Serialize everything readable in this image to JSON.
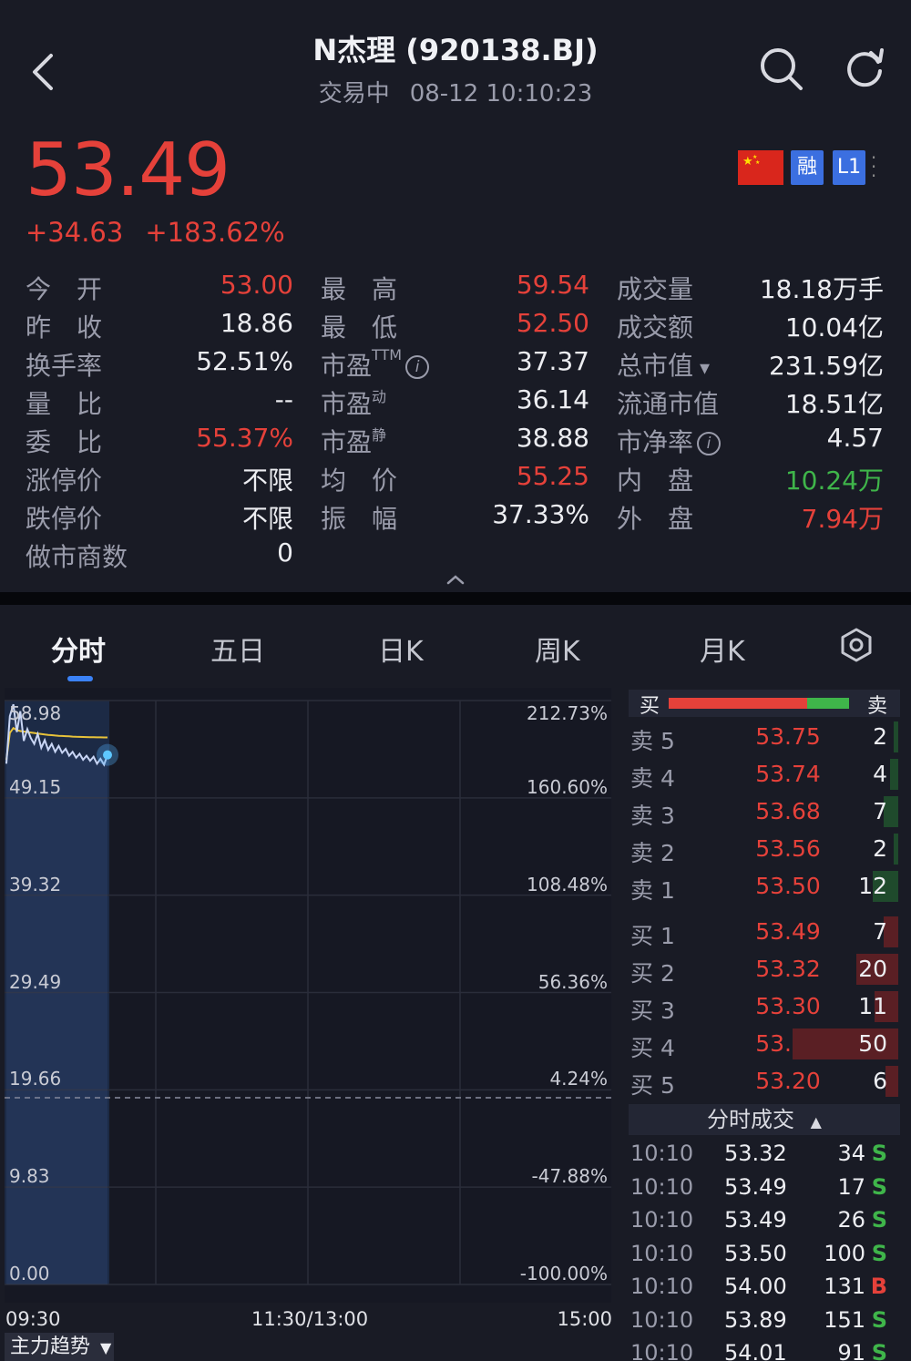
{
  "header": {
    "title": "N杰理 (920138.BJ)",
    "status": "交易中",
    "datetime": "08-12 10:10:23"
  },
  "quote": {
    "price": "53.49",
    "change": "+34.63",
    "change_pct": "+183.62%",
    "badges": {
      "margin": "融",
      "level": "L1"
    },
    "col1": [
      {
        "label": "今　开",
        "value": "53.00",
        "color": "red"
      },
      {
        "label": "昨　收",
        "value": "18.86",
        "color": "white"
      },
      {
        "label": "换手率",
        "value": "52.51%",
        "color": "white"
      },
      {
        "label": "量　比",
        "value": "--",
        "color": "white"
      },
      {
        "label": "委　比",
        "value": "55.37%",
        "color": "red"
      },
      {
        "label": "涨停价",
        "value": "不限",
        "color": "white"
      },
      {
        "label": "跌停价",
        "value": "不限",
        "color": "white"
      },
      {
        "label": "做市商数",
        "value": "0",
        "color": "white"
      }
    ],
    "col2": [
      {
        "label": "最　高",
        "value": "59.54",
        "color": "red"
      },
      {
        "label": "最　低",
        "value": "52.50",
        "color": "red"
      },
      {
        "label": "市盈",
        "sup": "TTM",
        "value": "37.37",
        "color": "white"
      },
      {
        "label": "市盈",
        "sup": "动",
        "value": "36.14",
        "color": "white"
      },
      {
        "label": "市盈",
        "sup": "静",
        "value": "38.88",
        "color": "white"
      },
      {
        "label": "均　价",
        "value": "55.25",
        "color": "red"
      },
      {
        "label": "振　幅",
        "value": "37.33%",
        "color": "white"
      }
    ],
    "col3": [
      {
        "label": "成交量",
        "value": "18.18万手",
        "color": "white"
      },
      {
        "label": "成交额",
        "value": "10.04亿",
        "color": "white"
      },
      {
        "label": "总市值",
        "value": "231.59亿",
        "color": "white"
      },
      {
        "label": "流通市值",
        "value": "18.51亿",
        "color": "white"
      },
      {
        "label": "市净率",
        "value": "4.57",
        "color": "white"
      },
      {
        "label": "内　盘",
        "value": "10.24万",
        "color": "green"
      },
      {
        "label": "外　盘",
        "value": "7.94万",
        "color": "red"
      }
    ]
  },
  "tabs": [
    "分时",
    "五日",
    "日K",
    "周K",
    "月K"
  ],
  "chart_data": {
    "type": "line",
    "y_price_ticks": [
      "58.98",
      "49.15",
      "39.32",
      "29.49",
      "19.66",
      "9.83",
      "0.00"
    ],
    "y_pct_ticks": [
      "212.73%",
      "160.60%",
      "108.48%",
      "56.36%",
      "4.24%",
      "-47.88%",
      "-100.00%"
    ],
    "x_ticks": [
      "09:30",
      "11:30/13:00",
      "15:00"
    ],
    "ylim": [
      0,
      58.98
    ],
    "prev_close": 18.86,
    "series": [
      {
        "values": [
          52.6,
          57.4,
          58.6,
          55.8,
          57.9,
          54.9,
          56.1,
          55.2,
          54.6,
          55.6,
          54.2,
          55.0,
          54.0,
          54.6,
          53.8,
          54.4,
          53.7,
          54.1,
          53.4,
          53.8,
          53.2,
          53.6,
          53.0,
          53.4,
          52.9,
          53.3,
          52.6,
          53.1,
          52.5,
          53.49
        ]
      },
      {
        "values": [
          53.0,
          55.7,
          56.2,
          56.0,
          55.9,
          55.85,
          55.8,
          55.75,
          55.7,
          55.65,
          55.6,
          55.55,
          55.5,
          55.48,
          55.45,
          55.42,
          55.4,
          55.38,
          55.36,
          55.34,
          55.32,
          55.31,
          55.3,
          55.29,
          55.28,
          55.27,
          55.26,
          55.26,
          55.25,
          55.25
        ]
      }
    ]
  },
  "orderbook": {
    "buy_label": "买",
    "sell_label": "卖",
    "asks": [
      {
        "label": "卖 5",
        "price": "53.75",
        "qty": "2",
        "ratio": 0.04
      },
      {
        "label": "卖 4",
        "price": "53.74",
        "qty": "4",
        "ratio": 0.08
      },
      {
        "label": "卖 3",
        "price": "53.68",
        "qty": "7",
        "ratio": 0.14
      },
      {
        "label": "卖 2",
        "price": "53.56",
        "qty": "2",
        "ratio": 0.04
      },
      {
        "label": "卖 1",
        "price": "53.50",
        "qty": "12",
        "ratio": 0.24
      }
    ],
    "bids": [
      {
        "label": "买 1",
        "price": "53.49",
        "qty": "7",
        "ratio": 0.14
      },
      {
        "label": "买 2",
        "price": "53.32",
        "qty": "20",
        "ratio": 0.4
      },
      {
        "label": "买 3",
        "price": "53.30",
        "qty": "11",
        "ratio": 0.22
      },
      {
        "label": "买 4",
        "price": "53.25",
        "qty": "50",
        "ratio": 1.0
      },
      {
        "label": "买 5",
        "price": "53.20",
        "qty": "6",
        "ratio": 0.12
      }
    ],
    "bid_share": 0.77
  },
  "ticks_title": "分时成交",
  "ticks": [
    {
      "time": "10:10",
      "price": "53.32",
      "vol": "34",
      "side": "S"
    },
    {
      "time": "10:10",
      "price": "53.49",
      "vol": "17",
      "side": "S"
    },
    {
      "time": "10:10",
      "price": "53.49",
      "vol": "26",
      "side": "S"
    },
    {
      "time": "10:10",
      "price": "53.50",
      "vol": "100",
      "side": "S"
    },
    {
      "time": "10:10",
      "price": "54.00",
      "vol": "131",
      "side": "B"
    },
    {
      "time": "10:10",
      "price": "53.89",
      "vol": "151",
      "side": "S"
    },
    {
      "time": "10:10",
      "price": "54.01",
      "vol": "91",
      "side": "S"
    }
  ],
  "trend_button": "主力趋势",
  "colors": {
    "up": "#e5413a",
    "down": "#3fb54a",
    "accent": "#3b82f6",
    "avg_line": "#e8c33a",
    "price_line": "#c9d6f5"
  },
  "icons": [
    "back-icon",
    "search-icon",
    "refresh-icon",
    "cn-flag-icon",
    "settings-icon",
    "collapse-icon"
  ]
}
